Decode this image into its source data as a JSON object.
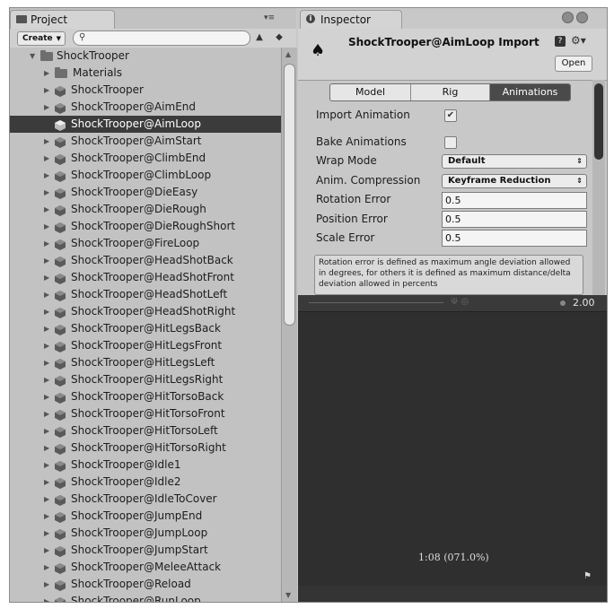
{
  "project": {
    "tab_label": "Project",
    "create_label": "Create",
    "search_value": "",
    "root_label": "ShockTrooper",
    "materials_label": "Materials",
    "items": [
      "ShockTrooper",
      "ShockTrooper@AimEnd",
      "ShockTrooper@AimLoop",
      "ShockTrooper@AimStart",
      "ShockTrooper@ClimbEnd",
      "ShockTrooper@ClimbLoop",
      "ShockTrooper@DieEasy",
      "ShockTrooper@DieRough",
      "ShockTrooper@DieRoughShort",
      "ShockTrooper@FireLoop",
      "ShockTrooper@HeadShotBack",
      "ShockTrooper@HeadShotFront",
      "ShockTrooper@HeadShotLeft",
      "ShockTrooper@HeadShotRight",
      "ShockTrooper@HitLegsBack",
      "ShockTrooper@HitLegsFront",
      "ShockTrooper@HitLegsLeft",
      "ShockTrooper@HitLegsRight",
      "ShockTrooper@HitTorsoBack",
      "ShockTrooper@HitTorsoFront",
      "ShockTrooper@HitTorsoLeft",
      "ShockTrooper@HitTorsoRight",
      "ShockTrooper@Idle1",
      "ShockTrooper@Idle2",
      "ShockTrooper@IdleToCover",
      "ShockTrooper@JumpEnd",
      "ShockTrooper@JumpLoop",
      "ShockTrooper@JumpStart",
      "ShockTrooper@MeleeAttack",
      "ShockTrooper@Reload",
      "ShockTrooper@RunLoop"
    ],
    "selected_item": "ShockTrooper@AimLoop"
  },
  "inspector": {
    "tab_label": "Inspector",
    "title": "ShockTrooper@AimLoop Import",
    "open_label": "Open",
    "tabs": [
      "Model",
      "Rig",
      "Animations"
    ],
    "active_tab": "Animations",
    "import_animation_label": "Import Animation",
    "import_animation_checked": true,
    "bake_animations_label": "Bake Animations",
    "bake_animations_checked": false,
    "wrap_mode_label": "Wrap Mode",
    "wrap_mode_value": "Default",
    "anim_compression_label": "Anim. Compression",
    "anim_compression_value": "Keyframe Reduction",
    "rotation_error_label": "Rotation Error",
    "rotation_error_value": "0.5",
    "position_error_label": "Position Error",
    "position_error_value": "0.5",
    "scale_error_label": "Scale Error",
    "scale_error_value": "0.5",
    "help_text": "Rotation error is defined as maximum angle deviation allowed in degrees, for others it is defined as maximum distance/delta deviation allowed in percents"
  },
  "preview": {
    "speed": "2.00",
    "time": "1:08 (071.0%)"
  },
  "colors": {
    "selection": "#3b3b3b",
    "preview_bg": "#2f2f2f",
    "panel_bg": "#c2c2c2"
  }
}
